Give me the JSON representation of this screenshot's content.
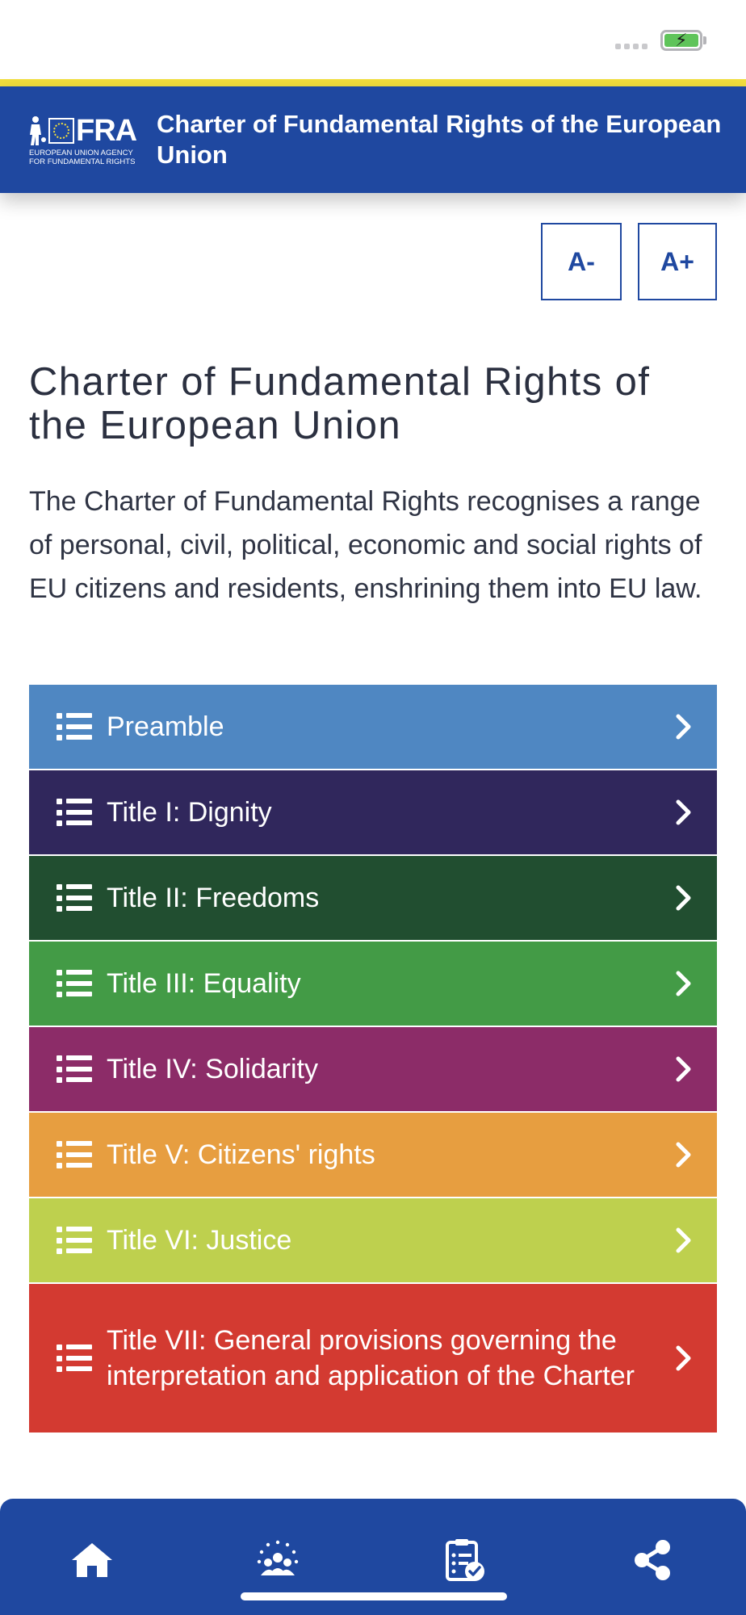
{
  "header": {
    "logo_word": "FRA",
    "logo_subtitle_1": "EUROPEAN UNION AGENCY",
    "logo_subtitle_2": "FOR FUNDAMENTAL RIGHTS",
    "title": "Charter of Fundamental Rights of the European Union",
    "brand_color": "#1f48a0",
    "accent_color": "#f2de3c"
  },
  "font_controls": {
    "decrease_label": "A-",
    "increase_label": "A+"
  },
  "main": {
    "title": "Charter of Fundamental Rights of the European Union",
    "intro": "The Charter of Fundamental Rights recognises a range of personal, civil, political, economic and social rights of EU citizens and residents, enshrining them into EU law.",
    "items": [
      {
        "label": "Preamble",
        "color": "#4f87c2",
        "icon": "list-icon"
      },
      {
        "label": "Title I: Dignity",
        "color": "#30275c",
        "icon": "list-icon"
      },
      {
        "label": "Title II: Freedoms",
        "color": "#214e30",
        "icon": "list-icon"
      },
      {
        "label": "Title III: Equality",
        "color": "#439b46",
        "icon": "list-icon"
      },
      {
        "label": "Title IV: Solidarity",
        "color": "#8c2c68",
        "icon": "list-icon"
      },
      {
        "label": "Title V: Citizens' rights",
        "color": "#e79e40",
        "icon": "list-icon"
      },
      {
        "label": "Title VI: Justice",
        "color": "#bed04e",
        "icon": "list-icon"
      },
      {
        "label": "Title VII: General provisions governing the interpretation and application of the Charter",
        "color": "#d33a31",
        "icon": "list-icon"
      }
    ]
  },
  "bottom_nav": {
    "icons": [
      "home-icon",
      "community-icon",
      "checklist-icon",
      "share-icon"
    ]
  }
}
